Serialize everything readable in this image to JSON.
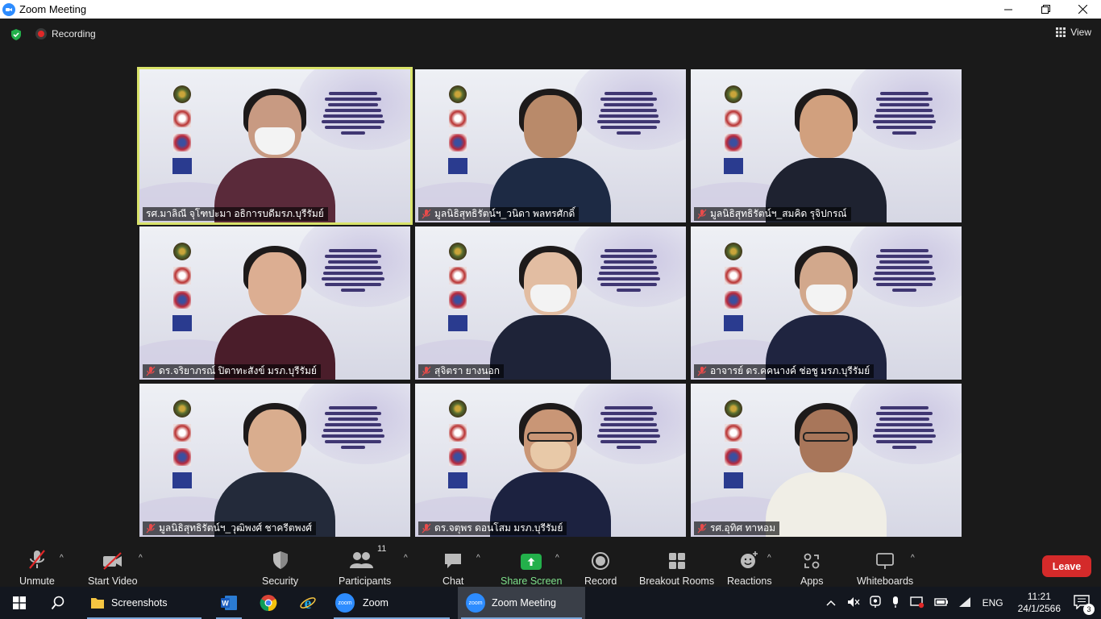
{
  "window": {
    "title": "Zoom Meeting"
  },
  "topbar": {
    "recording_label": "Recording",
    "view_label": "View"
  },
  "tiles": [
    {
      "name": "รศ.มาลิณี จุโฑปะมา อธิการบดีมรภ.บุรีรัมย์",
      "muted": false,
      "active": true
    },
    {
      "name": "มูลนิธิสุทธิรัตน์ฯ_วนิดา พลทรศักดิ์",
      "muted": true
    },
    {
      "name": "มูลนิธิสุทธิรัตน์ฯ_สมคิด รุจิปกรณ์",
      "muted": true
    },
    {
      "name": "ดร.จริยาภรณ์ ปิตาทะสังข์ มรภ.บุรีรัมย์",
      "muted": true
    },
    {
      "name": "สุจิตรา  ยางนอก",
      "muted": true
    },
    {
      "name": "อาจารย์ ดร.คคนางค์ ช่อชู มรภ.บุรีรัมย์",
      "muted": true
    },
    {
      "name": "มูลนิธิสุทธิรัตน์ฯ_วุฒิพงศ์ ชาครีตพงศ์",
      "muted": true
    },
    {
      "name": "ดร.จตุพร ดอนโสม มรภ.บุรีรัมย์",
      "muted": true
    },
    {
      "name": "รศ.อุทิศ ทาหอม",
      "muted": true
    }
  ],
  "toolbar": {
    "unmute": "Unmute",
    "start_video": "Start Video",
    "security": "Security",
    "participants": "Participants",
    "participant_count": "11",
    "chat": "Chat",
    "share_screen": "Share Screen",
    "record": "Record",
    "breakout_rooms": "Breakout Rooms",
    "reactions": "Reactions",
    "apps": "Apps",
    "whiteboards": "Whiteboards",
    "leave": "Leave"
  },
  "taskbar": {
    "apps": [
      {
        "label": "Screenshots",
        "icon": "folder-icon"
      },
      {
        "label": "",
        "icon": "word-icon"
      },
      {
        "label": "",
        "icon": "chrome-icon"
      },
      {
        "label": "",
        "icon": "ie-icon"
      },
      {
        "label": "Zoom",
        "icon": "zoom-icon"
      },
      {
        "label": "Zoom Meeting",
        "icon": "zoom-icon"
      }
    ],
    "language": "ENG",
    "time": "11:21",
    "date": "24/1/2566",
    "notifications": "3"
  },
  "colors": {
    "accent_green": "#23b04b",
    "leave_red": "#d42a2a",
    "active_speaker": "#d9e36a"
  }
}
